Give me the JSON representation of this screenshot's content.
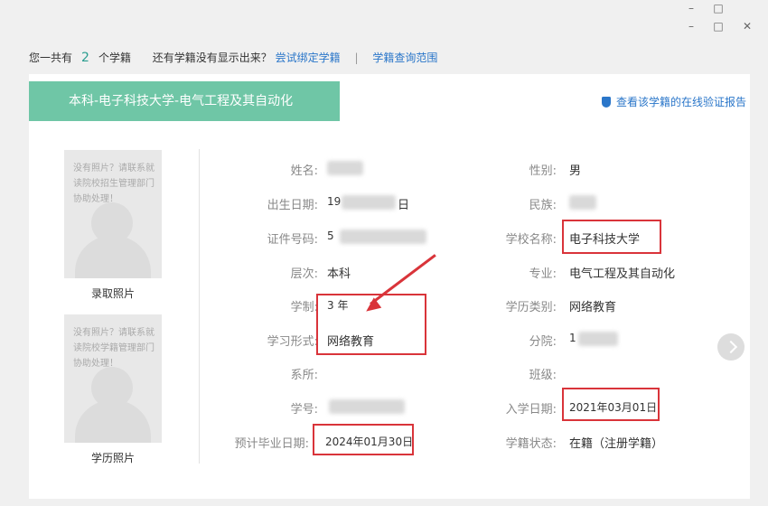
{
  "topbar": {
    "prefix": "您一共有",
    "count": "2",
    "suffix": "个学籍",
    "question": "还有学籍没有显示出来？",
    "bind_link": "尝试绑定学籍",
    "separator": "|",
    "scope_link": "学籍查询范围"
  },
  "record": {
    "title": "本科-电子科技大学-电气工程及其自动化",
    "verify_link": "查看该学籍的在线验证报告"
  },
  "photos": [
    {
      "note": "没有照片？请联系就读院校招生管理部门协助处理！",
      "label": "录取照片"
    },
    {
      "note": "没有照片？请联系就读院校学籍管理部门协助处理！",
      "label": "学历照片"
    }
  ],
  "fields": {
    "name_label": "姓名:",
    "birth_label": "出生日期:",
    "birth_prefix": "19",
    "birth_suffix": "日",
    "id_label": "证件号码:",
    "id_prefix": "5",
    "level_label": "层次:",
    "level_value": "本科",
    "duration_label": "学制:",
    "duration_value": "3 年",
    "mode_label": "学习形式:",
    "mode_value": "网络教育",
    "dept_label": "系所:",
    "student_no_label": "学号:",
    "grad_label": "预计毕业日期:",
    "grad_value": "2024年01月30日",
    "gender_label": "性别:",
    "gender_value": "男",
    "ethnic_label": "民族:",
    "school_label": "学校名称:",
    "school_value": "电子科技大学",
    "major_label": "专业:",
    "major_value": "电气工程及其自动化",
    "edu_type_label": "学历类别:",
    "edu_type_value": "网络教育",
    "branch_label": "分院:",
    "branch_prefix": "1",
    "class_label": "班级:",
    "enroll_label": "入学日期:",
    "enroll_value": "2021年03月01日",
    "status_label": "学籍状态:",
    "status_value": "在籍（注册学籍）"
  },
  "colors": {
    "banner": "#6fc6a6",
    "link": "#2a76c9",
    "highlight": "#d9343a"
  }
}
